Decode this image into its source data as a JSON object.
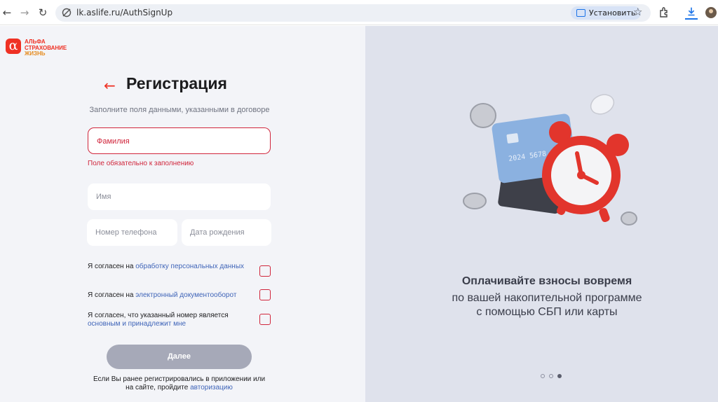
{
  "browser": {
    "url": "lk.aslife.ru/AuthSignUp",
    "install_label": "Установить"
  },
  "brand": {
    "logo_lines": [
      "АЛЬФА",
      "СТРАХОВАНИЕ",
      "ЖИЗНЬ"
    ],
    "logo_mark": "α",
    "accent_color": "#ef3124"
  },
  "form": {
    "title": "Регистрация",
    "subtitle": "Заполните поля данными, указанными в договоре",
    "surname_placeholder": "Фамилия",
    "surname_error": "Поле обязательно к заполнению",
    "name_placeholder": "Имя",
    "phone_placeholder": "Номер телефона",
    "birthdate_placeholder": "Дата рождения",
    "consent_personal_prefix": "Я согласен на ",
    "consent_personal_link": "обработку персональных данных",
    "consent_edo_prefix": "Я согласен на ",
    "consent_edo_link": "электронный документооборот",
    "consent_phone_prefix": "Я согласен, что указанный номер является ",
    "consent_phone_link": "основным и принадлежит мне",
    "next_label": "Далее",
    "footer_prefix": "Если Вы ранее регистрировались в приложении или на сайте, пройдите ",
    "footer_link": "авторизацию"
  },
  "promo": {
    "title": "Оплачивайте взносы вовремя",
    "line1": "по вашей накопительной программе",
    "line2": "с помощью СБП или карты",
    "card_number": "2024 5678 9012",
    "slides_total": 3,
    "active_slide": 3
  },
  "colors": {
    "error": "#d0253b",
    "link": "#3f64b8",
    "button_disabled": "#a6a9b8"
  }
}
